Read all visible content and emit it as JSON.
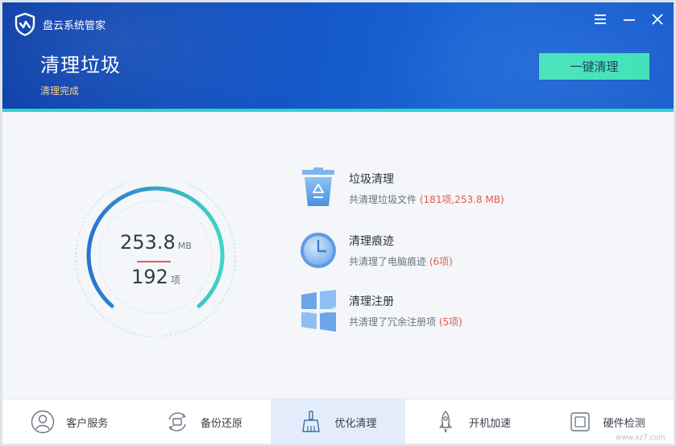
{
  "app": {
    "name": "盘云系统管家"
  },
  "header": {
    "title": "清理垃圾",
    "status": "清理完成",
    "action_label": "一键清理"
  },
  "gauge": {
    "size_value": "253.8",
    "size_unit": "MB",
    "count_value": "192",
    "count_unit": "项"
  },
  "results": [
    {
      "title": "垃圾清理",
      "prefix": "共清理垃圾文件",
      "highlight": "(181项,253.8 MB)",
      "icon": "trash-icon"
    },
    {
      "title": "清理痕迹",
      "prefix": "共清理了电脑痕迹",
      "highlight": "(6项)",
      "icon": "clock-icon"
    },
    {
      "title": "清理注册",
      "prefix": "共清理了冗余注册项",
      "highlight": "(5项)",
      "icon": "registry-icon"
    }
  ],
  "nav": [
    {
      "label": "客户服务",
      "icon": "user-icon",
      "active": false
    },
    {
      "label": "备份还原",
      "icon": "backup-icon",
      "active": false
    },
    {
      "label": "优化清理",
      "icon": "broom-icon",
      "active": true
    },
    {
      "label": "开机加速",
      "icon": "rocket-icon",
      "active": false
    },
    {
      "label": "硬件检测",
      "icon": "hardware-icon",
      "active": false
    }
  ],
  "watermark": "www.xz7.com",
  "colors": {
    "header_start": "#0d3fa8",
    "header_end": "#1a66d6",
    "accent": "#3ee1b8",
    "accent_line": "#2fd3c8",
    "status_text": "#f4d58a",
    "highlight": "#e05a4f"
  }
}
